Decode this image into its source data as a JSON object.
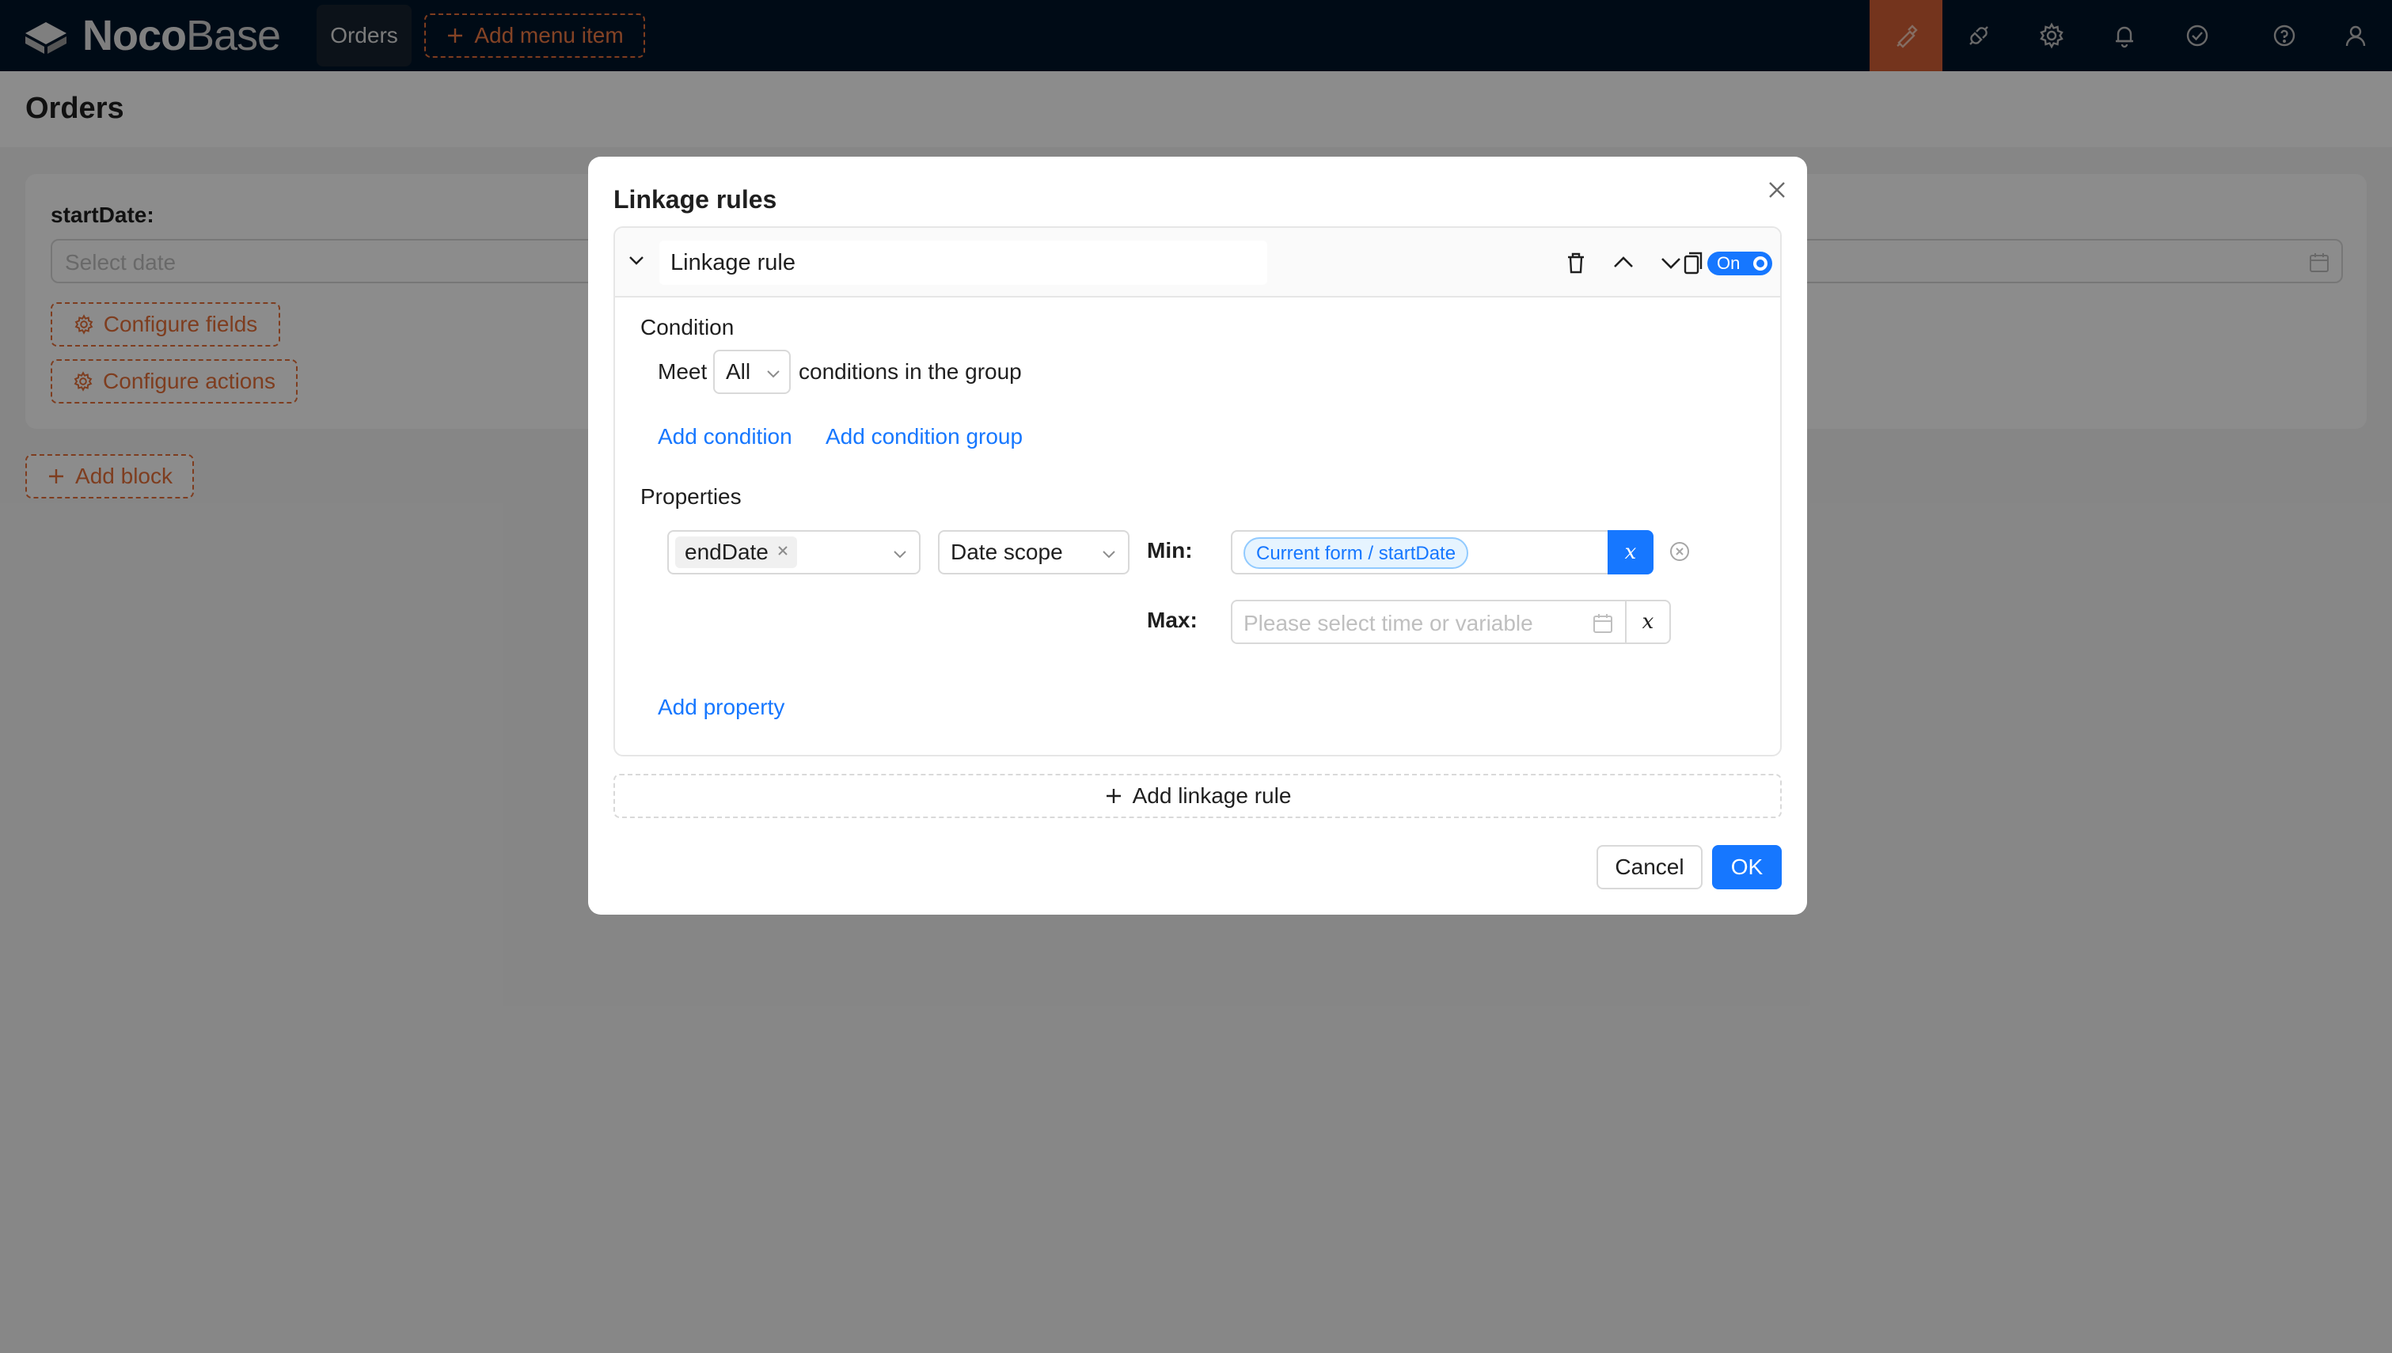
{
  "app": {
    "logo_bold": "Noco",
    "logo_light": "Base",
    "nav_item": "Orders",
    "add_menu_item": "Add menu item"
  },
  "toolbar_icons": [
    "ui-editor-icon",
    "plugin-icon",
    "settings-icon",
    "bell-icon",
    "check-circle-icon",
    "help-icon",
    "user-icon"
  ],
  "page": {
    "title": "Orders",
    "field_label": "startDate",
    "date_placeholder": "Select date",
    "configure_fields": "Configure fields",
    "configure_actions": "Configure actions",
    "add_block": "Add block"
  },
  "modal": {
    "title": "Linkage rules",
    "rule": {
      "name": "Linkage rule",
      "toggle_label": "On",
      "enabled": true
    },
    "condition": {
      "section_label": "Condition",
      "meet": "Meet",
      "match_value": "All",
      "suffix": "conditions in the group",
      "add_condition": "Add condition",
      "add_condition_group": "Add condition group"
    },
    "properties": {
      "section_label": "Properties",
      "field_tag": "endDate",
      "action_value": "Date scope",
      "min_label": "Min",
      "min_value": "Current form / startDate",
      "max_label": "Max",
      "max_placeholder": "Please select time or variable",
      "variable_button": "x",
      "add_property": "Add property"
    },
    "add_linkage_rule": "Add linkage rule",
    "cancel": "Cancel",
    "ok": "OK"
  },
  "colors": {
    "topbar": "#001529",
    "accent_orange": "#e5703a",
    "primary_blue": "#1677ff"
  }
}
